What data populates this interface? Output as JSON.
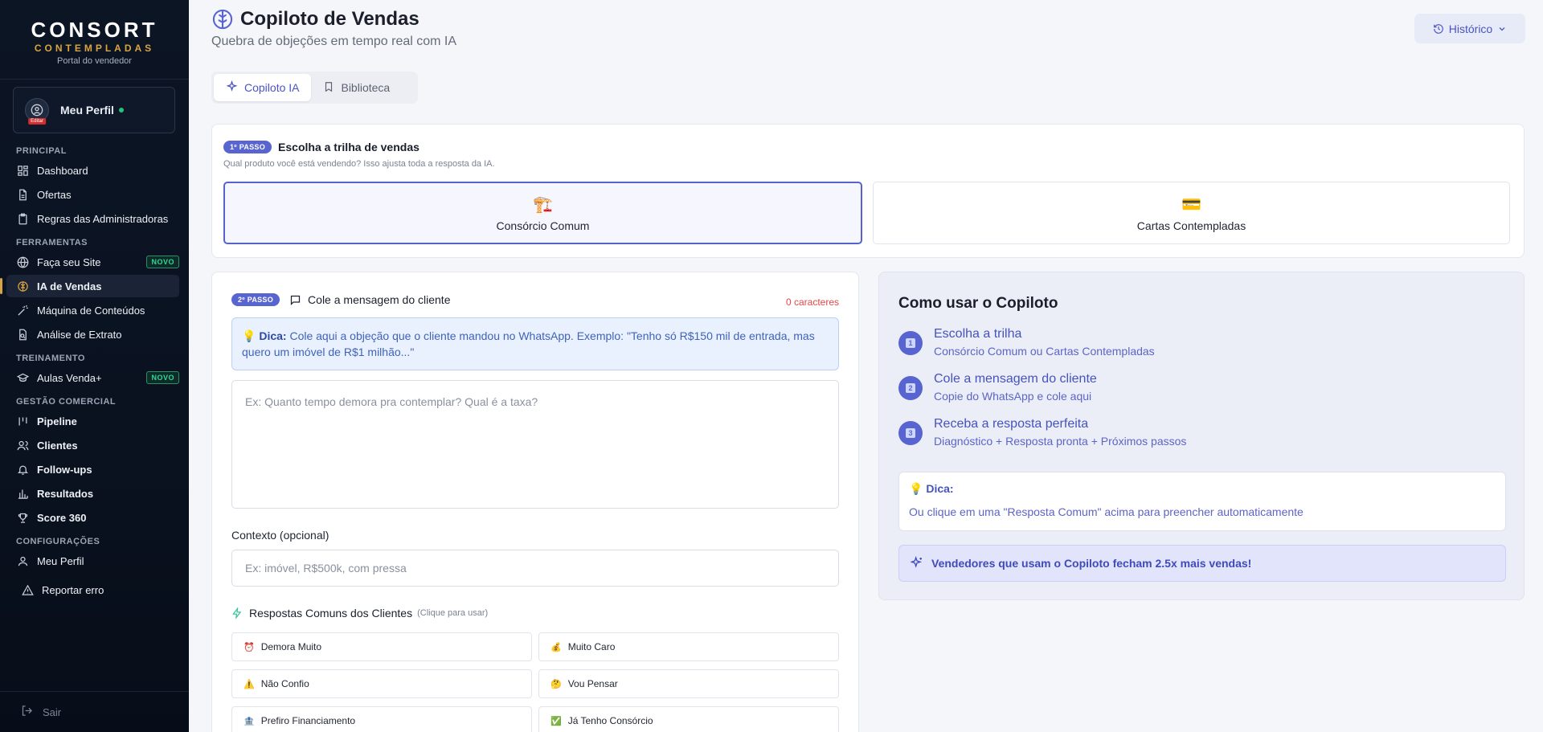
{
  "sidebar": {
    "brand_name": "CONSORT",
    "brand_sub": "CONTEMPLADAS",
    "brand_portal": "Portal do vendedor",
    "profile": {
      "name": "Meu Perfil",
      "edit_label": "Editar"
    },
    "sections": {
      "principal": "PRINCIPAL",
      "ferramentas": "FERRAMENTAS",
      "treinamento": "TREINAMENTO",
      "gestao": "GESTÃO COMERCIAL",
      "config": "CONFIGURAÇÕES"
    },
    "items": {
      "dashboard": "Dashboard",
      "ofertas": "Ofertas",
      "regras": "Regras das Administradoras",
      "site": "Faça seu Site",
      "ia": "IA de Vendas",
      "maquina": "Máquina de Conteúdos",
      "extrato": "Análise de Extrato",
      "aulas": "Aulas Venda+",
      "pipeline": "Pipeline",
      "clientes": "Clientes",
      "followups": "Follow-ups",
      "resultados": "Resultados",
      "score": "Score 360",
      "meuperfil": "Meu Perfil",
      "reportar": "Reportar erro"
    },
    "badge_novo": "NOVO",
    "logout": "Sair",
    "accent_color": "#d9a441"
  },
  "header": {
    "title": "Copiloto de Vendas",
    "subtitle": "Quebra de objeções em tempo real com IA",
    "history_label": "Histórico"
  },
  "tabs": [
    {
      "label": "Copiloto IA",
      "active": true
    },
    {
      "label": "Biblioteca",
      "active": false
    }
  ],
  "step1": {
    "badge": "1º PASSO",
    "title": "Escolha a trilha de vendas",
    "hint": "Qual produto você está vendendo? Isso ajusta toda a resposta da IA.",
    "options": [
      {
        "emoji": "🏗️",
        "label": "Consórcio Comum",
        "selected": true
      },
      {
        "emoji": "💳",
        "label": "Cartas Contempladas",
        "selected": false
      }
    ]
  },
  "step2": {
    "badge": "2º PASSO",
    "title": "Cole a mensagem do cliente",
    "char_count": "0 caracteres",
    "tip_label": "Dica:",
    "tip_text": "Cole aqui a objeção que o cliente mandou no WhatsApp. Exemplo: \"Tenho só R$150 mil de entrada, mas quero um imóvel de R$1 milhão...\"",
    "message_placeholder": "Ex: Quanto tempo demora pra contemplar? Qual é a taxa?",
    "context_label": "Contexto (opcional)",
    "context_placeholder": "Ex: imóvel, R$500k, com pressa",
    "common_title": "Respostas Comuns dos Clientes",
    "common_hint": "(Clique para usar)",
    "common": [
      {
        "emoji": "⏰",
        "label": "Demora Muito"
      },
      {
        "emoji": "💰",
        "label": "Muito Caro"
      },
      {
        "emoji": "⚠️",
        "label": "Não Confio"
      },
      {
        "emoji": "🤔",
        "label": "Vou Pensar"
      },
      {
        "emoji": "🏦",
        "label": "Prefiro Financiamento"
      },
      {
        "emoji": "✅",
        "label": "Já Tenho Consórcio"
      }
    ]
  },
  "howto": {
    "title": "Como usar o Copiloto",
    "steps": [
      {
        "n": "1",
        "title": "Escolha a trilha",
        "desc": "Consórcio Comum ou Cartas Contempladas"
      },
      {
        "n": "2",
        "title": "Cole a mensagem do cliente",
        "desc": "Copie do WhatsApp e cole aqui"
      },
      {
        "n": "3",
        "title": "Receba a resposta perfeita",
        "desc": "Diagnóstico + Resposta pronta + Próximos passos"
      }
    ],
    "tip_label": "Dica:",
    "tip_text": "Ou clique em uma \"Resposta Comum\" acima para preencher automaticamente",
    "promo": "Vendedores que usam o Copiloto fecham 2.5x mais vendas!"
  }
}
